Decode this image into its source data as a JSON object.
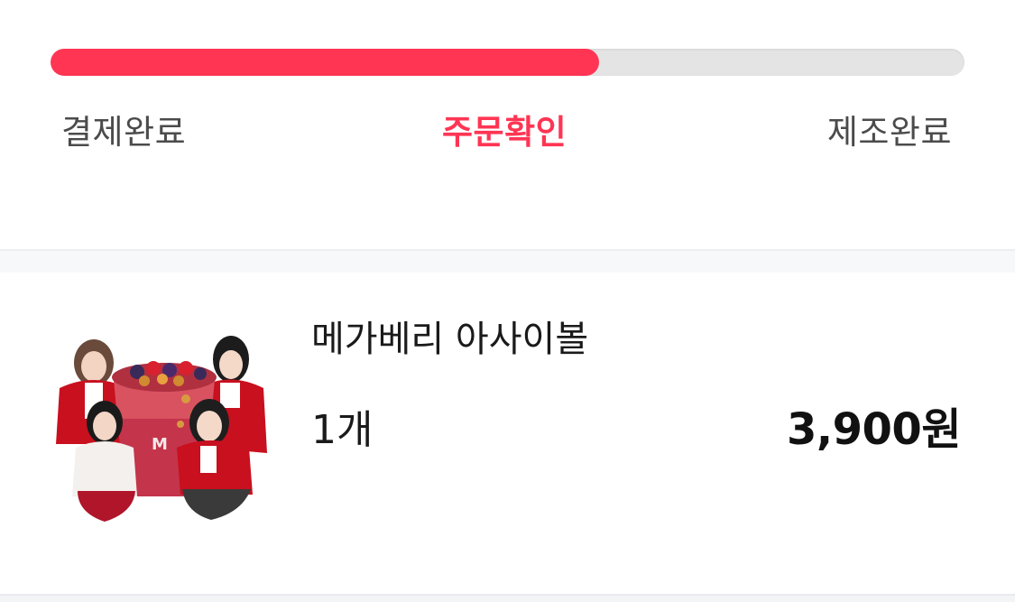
{
  "order_progress": {
    "completion": 0.6,
    "accent_color": "#ff3553",
    "steps": [
      {
        "label": "결제완료",
        "state": "done"
      },
      {
        "label": "주문확인",
        "state": "current"
      },
      {
        "label": "제조완료",
        "state": "pending"
      }
    ]
  },
  "order_item": {
    "name": "메가베리 아사이볼",
    "quantity": "1개",
    "price": "3,900원",
    "image_icon": "product-thumbnail-image"
  }
}
